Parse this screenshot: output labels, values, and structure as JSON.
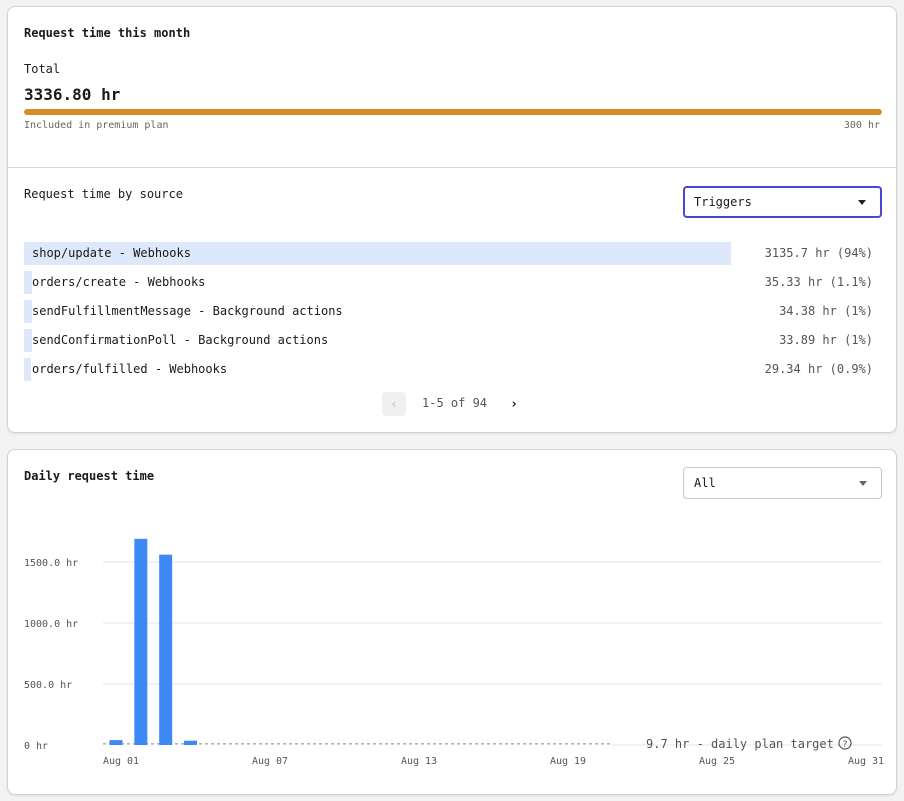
{
  "summary": {
    "title": "Request time this month",
    "total_label": "Total",
    "total_value": "3336.80 hr",
    "included_label": "Included in premium plan",
    "plan_limit_label": "300 hr",
    "usage_fraction": 1.0,
    "bar_color": "#d98a2b"
  },
  "by_source": {
    "title": "Request time by source",
    "filter": {
      "selected": "Triggers"
    },
    "rows": [
      {
        "name": "shop/update - Webhooks",
        "value": "3135.7 hr (94%)",
        "share": 0.94
      },
      {
        "name": "orders/create - Webhooks",
        "value": "35.33 hr (1.1%)",
        "share": 0.011
      },
      {
        "name": "sendFulfillmentMessage - Background actions",
        "value": "34.38 hr (1%)",
        "share": 0.01
      },
      {
        "name": "sendConfirmationPoll - Background actions",
        "value": "33.89 hr (1%)",
        "share": 0.01
      },
      {
        "name": "orders/fulfilled - Webhooks",
        "value": "29.34 hr (0.9%)",
        "share": 0.009
      }
    ],
    "pagination": {
      "text": "1-5 of 94",
      "prev_icon": "chevron-left-icon",
      "next_icon": "chevron-right-icon"
    }
  },
  "daily": {
    "title": "Daily request time",
    "filter": {
      "selected": "All"
    },
    "target_label": "9.7 hr - daily plan target",
    "help_icon": "question-circle-icon"
  },
  "chart_data": {
    "type": "bar",
    "x_dates": [
      "Aug 01",
      "Aug 02",
      "Aug 03",
      "Aug 04",
      "Aug 05",
      "Aug 06",
      "Aug 07",
      "Aug 08",
      "Aug 09",
      "Aug 10",
      "Aug 11",
      "Aug 12",
      "Aug 13",
      "Aug 14",
      "Aug 15",
      "Aug 16",
      "Aug 17",
      "Aug 18",
      "Aug 19",
      "Aug 20",
      "Aug 21",
      "Aug 22",
      "Aug 23",
      "Aug 24",
      "Aug 25",
      "Aug 26",
      "Aug 27",
      "Aug 28",
      "Aug 29",
      "Aug 30",
      "Aug 31"
    ],
    "values": [
      40,
      1690,
      1560,
      35,
      0,
      0,
      0,
      0,
      0,
      0,
      0,
      0,
      0,
      0,
      0,
      0,
      0,
      0,
      0,
      0,
      0,
      0,
      0,
      0,
      0,
      0,
      0,
      0,
      0,
      0,
      0
    ],
    "x_tick_labels": [
      "Aug 01",
      "Aug 07",
      "Aug 13",
      "Aug 19",
      "Aug 25",
      "Aug 31"
    ],
    "y_ticks": [
      0,
      500,
      1000,
      1500
    ],
    "y_tick_labels": [
      "0 hr",
      "500.0 hr",
      "1000.0 hr",
      "1500.0 hr"
    ],
    "ylim": [
      0,
      1700
    ],
    "target_value": 9.7,
    "bar_color": "#3d8af7",
    "grid": true
  }
}
